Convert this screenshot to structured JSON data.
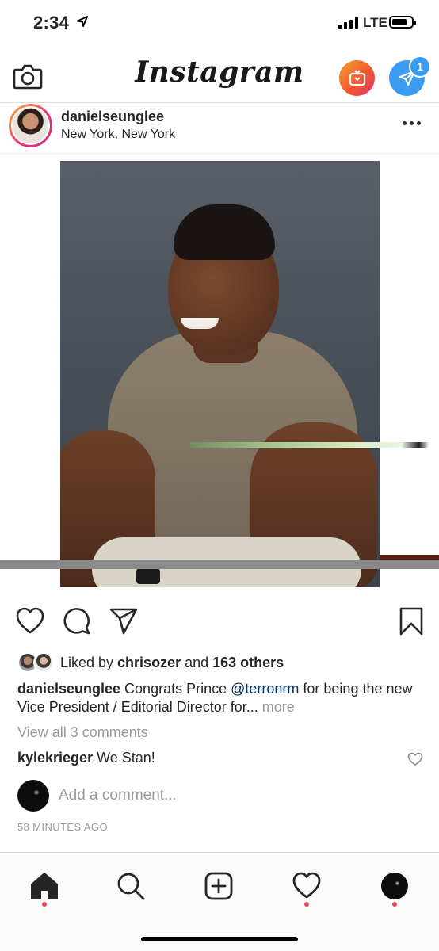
{
  "status_bar": {
    "time": "2:34",
    "network": "LTE",
    "battery_level": 0.78
  },
  "top_nav": {
    "logo": "Instagram",
    "direct_badge_count": "1",
    "icons": [
      "camera-icon",
      "igtv-icon",
      "direct-message-icon"
    ],
    "colors": {
      "igtv_gradient": [
        "#f6a02f",
        "#e2316c"
      ],
      "direct": "#3a9bf0"
    }
  },
  "post": {
    "username": "danielseunglee",
    "location": "New York, New York",
    "likes": {
      "prefix": "Liked by ",
      "user": "chrisozer",
      "middle": " and ",
      "count_text": "163 others"
    },
    "caption": {
      "username": "danielseunglee",
      "text_before": " Congrats Prince ",
      "mention": "@terronrm",
      "text_after": " for being the new Vice President / Editorial Director for... ",
      "more": "more"
    },
    "view_comments": "View all 3 comments",
    "comments": [
      {
        "username": "kylekrieger",
        "text": " We Stan!"
      }
    ],
    "add_comment_placeholder": "Add a comment...",
    "timestamp": "58 MINUTES AGO"
  },
  "tab_bar": {
    "items": [
      "home-icon",
      "search-icon",
      "new-post-icon",
      "activity-heart-icon",
      "profile-avatar"
    ],
    "notification_dot_color": "#ed4956"
  }
}
